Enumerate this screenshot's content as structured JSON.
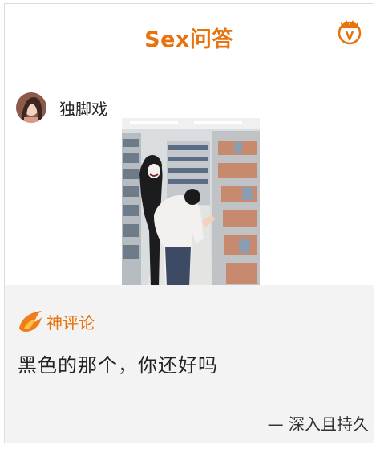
{
  "header": {
    "title": "Sex问答",
    "logo_icon": "crown-icon"
  },
  "post": {
    "author_name": "独脚戏",
    "avatar_icon": "avatar",
    "image_alt": "photo"
  },
  "comment": {
    "label": "神评论",
    "label_icon": "flame-icon",
    "text": "黑色的那个，你还好吗",
    "author": "— 深入且持久"
  },
  "colors": {
    "accent": "#e8720c",
    "panel": "#f3f3f3"
  }
}
